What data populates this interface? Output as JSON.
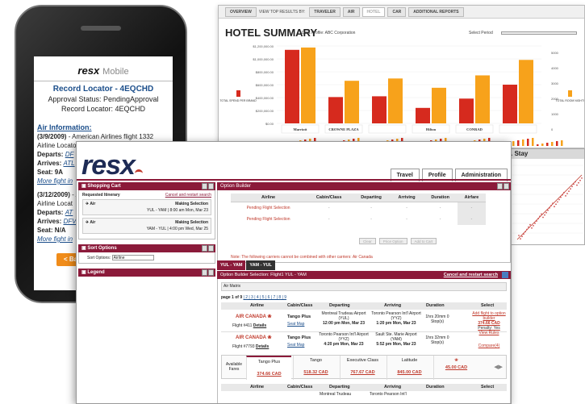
{
  "mobile": {
    "logo": "resx",
    "logo_sub": "Mobile",
    "record_locator_title": "Record Locator - 4EQCHD",
    "approval_status": "Approval Status: PendingApproval",
    "record_locator": "Record Locator: 4EQCHD",
    "air_info_title": "Air Information:",
    "seg1_date": "(3/9/2009)",
    "seg1_text": "- American Airlines flight 1332",
    "seg1_locator": "Airline Locator: BSSZYM",
    "seg1_departs_label": "Departs:",
    "seg1_departs_val": "DF",
    "seg1_arrives_label": "Arrives:",
    "seg1_arrives_val": "ATL",
    "seg1_seat": "Seat: 9A",
    "seg1_more": "More fight in",
    "seg2_date": "(3/12/2009)",
    "seg2_text": "- A",
    "seg2_locator": "Airline Locat",
    "seg2_departs_label": "Departs:",
    "seg2_departs_val": "AT",
    "seg2_arrives_label": "Arrives:",
    "seg2_arrives_val": "DFV",
    "seg2_seat": "Seat: N/A",
    "seg2_more": "More fight in",
    "back": "< Back"
  },
  "report": {
    "tabs": [
      "OVERVIEW",
      "VIEW TOP RESULTS BY:",
      "TRAVELER",
      "AIR",
      "HOTEL",
      "CAR",
      "ADDITIONAL REPORTS"
    ],
    "title": "HOTEL SUMMARY",
    "data_profile": "Data Profile: ABC Corporation",
    "select_period": "Select Period",
    "y_labels": [
      "$1,200,000.00",
      "$1,000,000.00",
      "$800,000.00",
      "$600,000.00",
      "$400,000.00",
      "$200,000.00",
      "$0.00"
    ],
    "legend_left": "TOTAL SPEND PER BRAND",
    "legend_right": "TOTAL ROOM NIGHTS",
    "brands": [
      "Marriott",
      "CROWNE PLAZA",
      "",
      "Hilton",
      "CONRAD",
      ""
    ],
    "right_axis": [
      "5000",
      "4000",
      "3000",
      "2000",
      "1000",
      "0"
    ]
  },
  "stay_chart": {
    "title": ". Stay"
  },
  "app": {
    "logo": "resx",
    "nav_tabs": [
      "Travel",
      "Profile",
      "Administration"
    ]
  },
  "cart": {
    "header": "Shopping Cart",
    "requested_itinerary": "Requested Itinerary",
    "cancel_restart": "Cancel and restart search",
    "items": [
      {
        "type": "Air",
        "status": "Making Selection",
        "line": "YUL - YAM | 8:00 am Mon, Mar 23"
      },
      {
        "type": "Air",
        "status": "Making Selection",
        "line": "YAM - YUL | 4:00 pm Wed, Mar 25"
      }
    ]
  },
  "sort": {
    "header": "Sort Options",
    "label": "Sort Options:",
    "value": "Airline"
  },
  "legend": {
    "header": "Legend"
  },
  "option_builder": {
    "header": "Option Builder",
    "columns": [
      "Airline",
      "Cabin/Class",
      "Departing",
      "Arriving",
      "Duration",
      "Airfare"
    ],
    "rows": [
      {
        "airline": "Pending Flight Selection",
        "cabin": "-",
        "dep": "-",
        "arr": "-",
        "dur": "-",
        "fare": "-"
      },
      {
        "airline": "Pending Flight Selection",
        "cabin": "-",
        "dep": "-",
        "arr": "-",
        "dur": "-",
        "fare": "-"
      }
    ],
    "buttons": [
      "Clear",
      "Price Option",
      "Add to Cart"
    ],
    "note": "Note: The following carriers cannot be combined with other carriers: Air Canada"
  },
  "routes": [
    "YUL - YAM",
    "YAM - YUL"
  ],
  "flights": {
    "header": "Option Builder Selection: Flight1 YUL - YAM",
    "cancel_restart": "Cancel and restart search",
    "matrix": "Air Matrix",
    "paging_label": "page 1 of 9",
    "pages": "| 2 | 3 | 4 | 5 | 6 | 7 | 8 | 9",
    "columns": [
      "Airline",
      "Cabin/Class",
      "Departing",
      "Arriving",
      "Duration",
      "Select"
    ],
    "rows": [
      {
        "airline": "AIR CANADA",
        "flight_prefix": "Flight #411",
        "details": "Details",
        "cabin": "Tango Plus",
        "seat": "Seat Map",
        "dep_airport": "Montreal Trudeau Airport (YUL)",
        "dep_time": "12:00 pm Mon, Mar 23",
        "arr_airport": "Toronto Pearson Int'l Airport (YYZ)",
        "arr_time": "1:20 pm Mon, Mar 23",
        "duration": "1hrs 20mm 0 Stop(s)",
        "select": "Add flight to option builder",
        "price": "374.66 CAD",
        "penalty": "Penalty: Yes",
        "rules": "View Rules",
        "compare": "Compare(4)"
      },
      {
        "airline": "AIR CANADA",
        "flight_prefix": "Flight #7793",
        "details": "Details",
        "cabin": "Tango Plus",
        "seat": "Seat Map",
        "dep_airport": "Toronto Pearson Int'l Airport (YYZ)",
        "dep_time": "4:20 pm Mon, Mar 23",
        "arr_airport": "Sault Ste. Marie Airport (YAM)",
        "arr_time": "5:52 pm Mon, Mar 23",
        "duration": "1hrs 32mm 0 Stop(s)"
      }
    ],
    "available_fares": "Available Fares",
    "fares": [
      {
        "name": "Tango Plus",
        "price": "374.66 CAD"
      },
      {
        "name": "Tango",
        "price": "518.32 CAD"
      },
      {
        "name": "Executive Class",
        "price": "767.67 CAD"
      },
      {
        "name": "Latitude",
        "price": "845.00 CAD"
      },
      {
        "name": "",
        "price": "45.00 CAD"
      }
    ],
    "row3_dep": "Montreal Trudeau",
    "row3_arr": "Toronto Pearson Int'l"
  },
  "colors": {
    "brand": "#8b1a3a",
    "navy": "#1d2b55",
    "bar_red": "#d62a1e",
    "bar_orange": "#f7a21b"
  }
}
